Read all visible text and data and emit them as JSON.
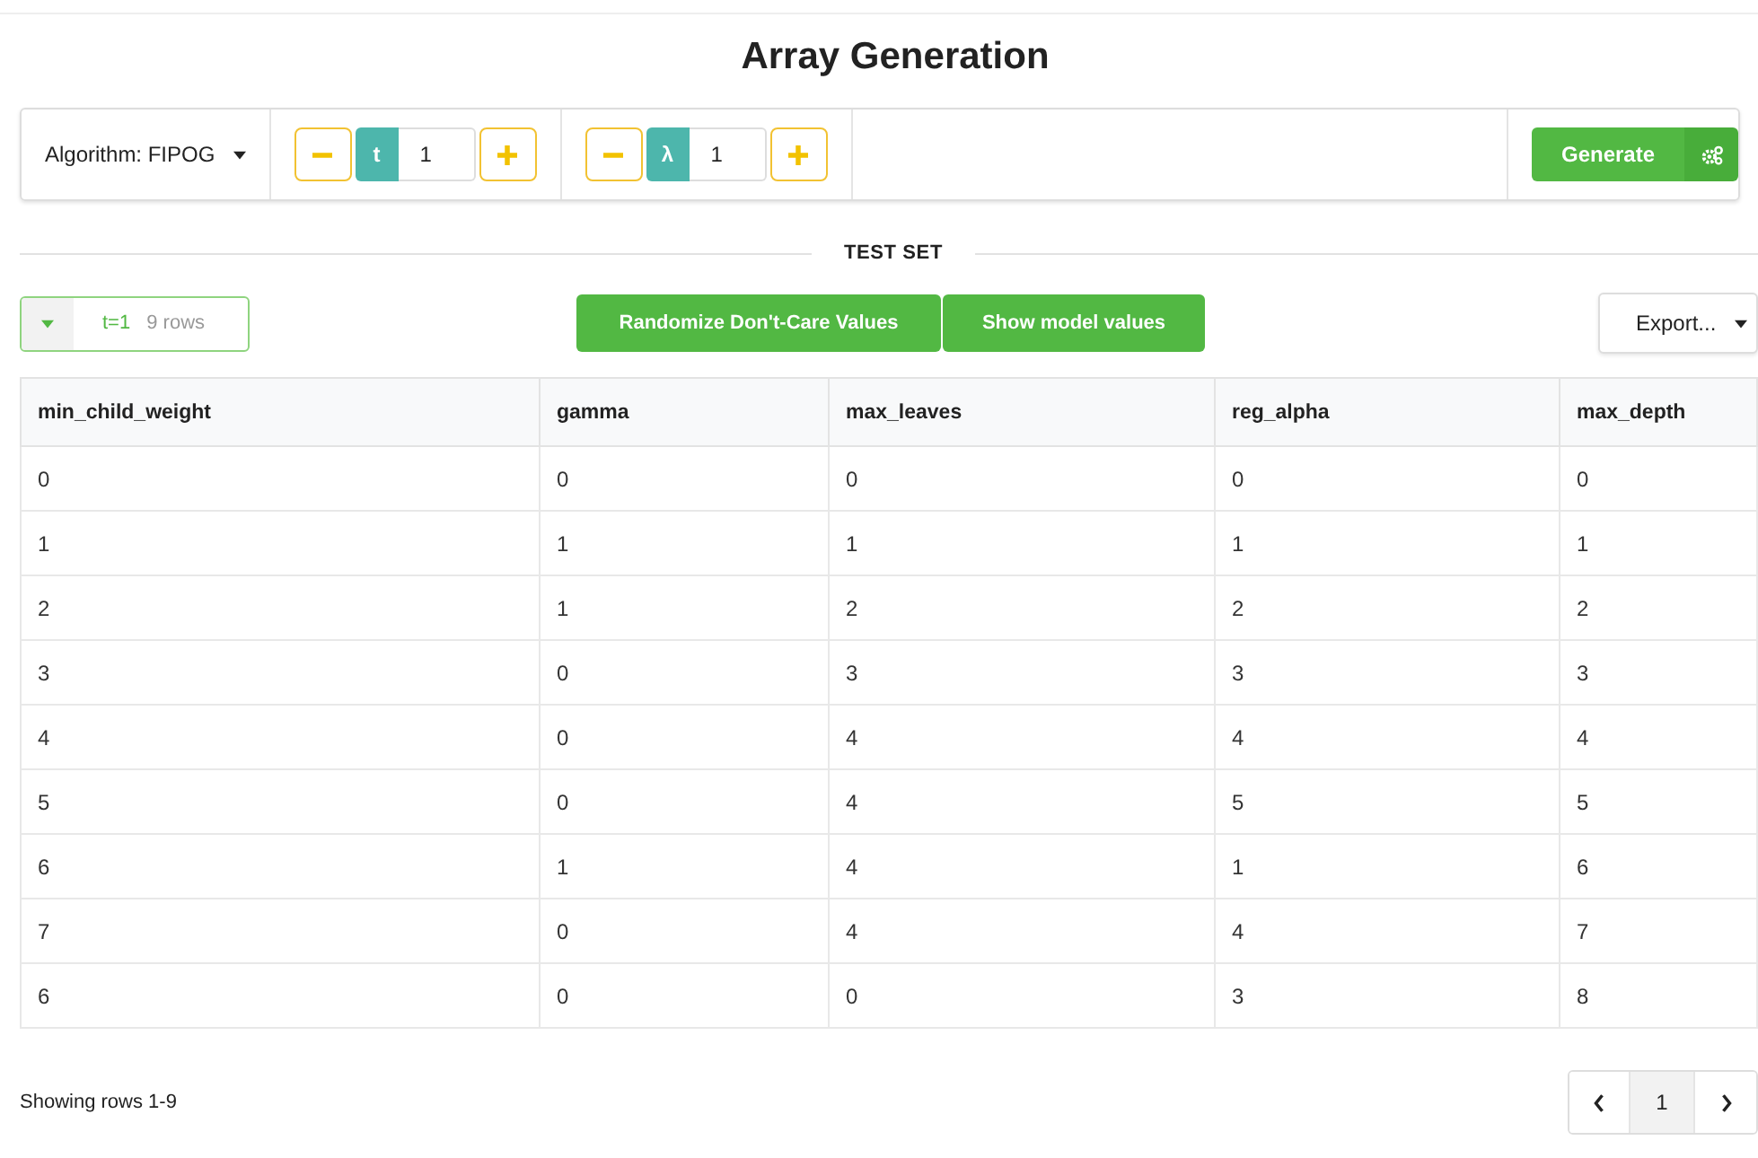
{
  "title": "Array Generation",
  "toolbar": {
    "algorithm": "Algorithm: FIPOG",
    "steppers": [
      {
        "label": "t",
        "value": "1"
      },
      {
        "label": "λ",
        "value": "1"
      }
    ],
    "generate": "Generate"
  },
  "section_title": "TEST SET",
  "set_selector": {
    "t_label": "t=1",
    "rows_label": "9 rows"
  },
  "actions": [
    "Randomize Don't-Care Values",
    "Show model values"
  ],
  "export": "Export...",
  "table": {
    "columns": [
      "min_child_weight",
      "gamma",
      "max_leaves",
      "reg_alpha",
      "max_depth"
    ],
    "rows": [
      [
        "0",
        "0",
        "0",
        "0",
        "0"
      ],
      [
        "1",
        "1",
        "1",
        "1",
        "1"
      ],
      [
        "2",
        "1",
        "2",
        "2",
        "2"
      ],
      [
        "3",
        "0",
        "3",
        "3",
        "3"
      ],
      [
        "4",
        "0",
        "4",
        "4",
        "4"
      ],
      [
        "5",
        "0",
        "4",
        "5",
        "5"
      ],
      [
        "6",
        "1",
        "4",
        "1",
        "6"
      ],
      [
        "7",
        "0",
        "4",
        "4",
        "7"
      ],
      [
        "6",
        "0",
        "0",
        "3",
        "8"
      ]
    ]
  },
  "footer": "Showing rows 1-9",
  "pagination": [
    {
      "label": "1",
      "selected": true
    }
  ]
}
